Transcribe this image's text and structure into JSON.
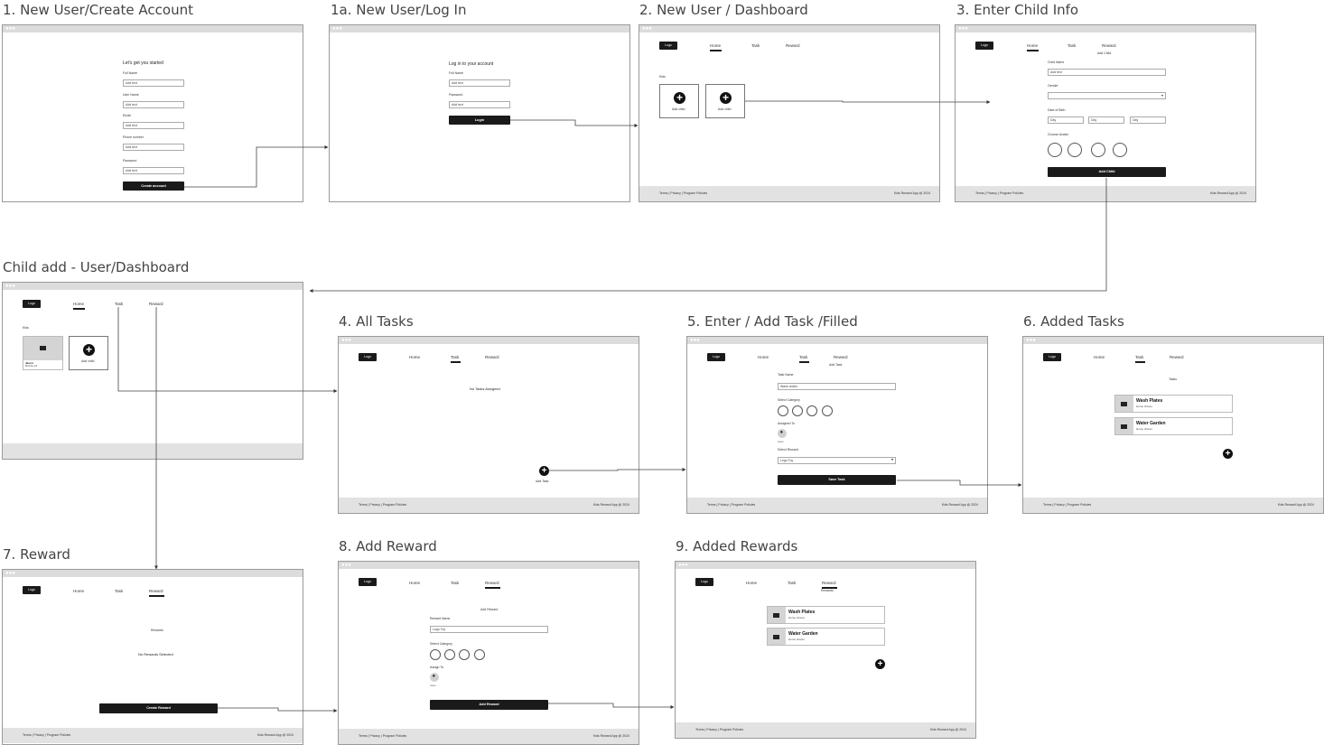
{
  "titles": {
    "s1": "1. New User/Create Account",
    "s1a": "1a. New User/Log In",
    "s2": "2. New User / Dashboard",
    "s3": "3. Enter Child Info",
    "sc": "Child add - User/Dashboard",
    "s4": "4. All Tasks",
    "s5": "5. Enter / Add Task /Filled",
    "s6": "6. Added Tasks",
    "s7": "7. Reward",
    "s8": "8. Add Reward",
    "s9": "9. Added Rewards"
  },
  "common": {
    "logo": "Logo",
    "nav_home": "Home",
    "nav_task": "Task",
    "nav_reward": "Reward",
    "footer_links": "Terms | Privacy | Program Policies",
    "footer_copy": "Kids Reward App @ 2024",
    "add_text": "Add text"
  },
  "s1": {
    "heading": "Let's get you started",
    "full_name": "Full Name",
    "user_name": "User Name",
    "email": "Email",
    "phone": "Phone number",
    "password": "Password",
    "button": "Create account"
  },
  "s1a": {
    "heading": "Log in to your account",
    "full_name": "Full Name",
    "password": "Password",
    "password_placeholder": "Add text",
    "button": "Login"
  },
  "s2": {
    "kids": "Kids",
    "add_child": "Add child"
  },
  "s3": {
    "heading": "Add Child",
    "child_name": "Child Name",
    "gender": "Gender",
    "dob": "Date of Birth",
    "day": "Day",
    "choose_avatar": "Choose Avatar",
    "button": "Add Child"
  },
  "sc": {
    "kids": "Kids",
    "add_child": "Add child",
    "child_name": "Jason",
    "child_sub": "Birthday left"
  },
  "s4": {
    "empty": "No Tasks Assigned",
    "add_task": "Add Task"
  },
  "s5": {
    "heading": "Add Task",
    "task_name": "Task Name",
    "task_value": "Wash cloths",
    "select_category": "Select Category",
    "assigned_to": "Assigned To",
    "assignee": "Jason",
    "select_reward": "Select Reward",
    "reward_value": "Lego Toy",
    "button": "Save Task"
  },
  "s6": {
    "heading": "Tasks",
    "items": [
      {
        "title": "Wash Plates",
        "sub": "Home chores"
      },
      {
        "title": "Water Garden",
        "sub": "Home chores"
      }
    ]
  },
  "s7": {
    "heading": "Rewards",
    "empty": "No Rewards Selected",
    "button": "Create Reward"
  },
  "s8": {
    "heading": "Add Reward",
    "reward_name": "Reward Name",
    "reward_value": "Lego Toy",
    "select_category": "Select Category",
    "assign_to": "Assign To",
    "assignee": "Jason",
    "button": "Add Reward"
  },
  "s9": {
    "heading": "Rewards",
    "items": [
      {
        "title": "Wash Plates",
        "sub": "Home chores"
      },
      {
        "title": "Water Garden",
        "sub": "Home chores"
      }
    ]
  }
}
